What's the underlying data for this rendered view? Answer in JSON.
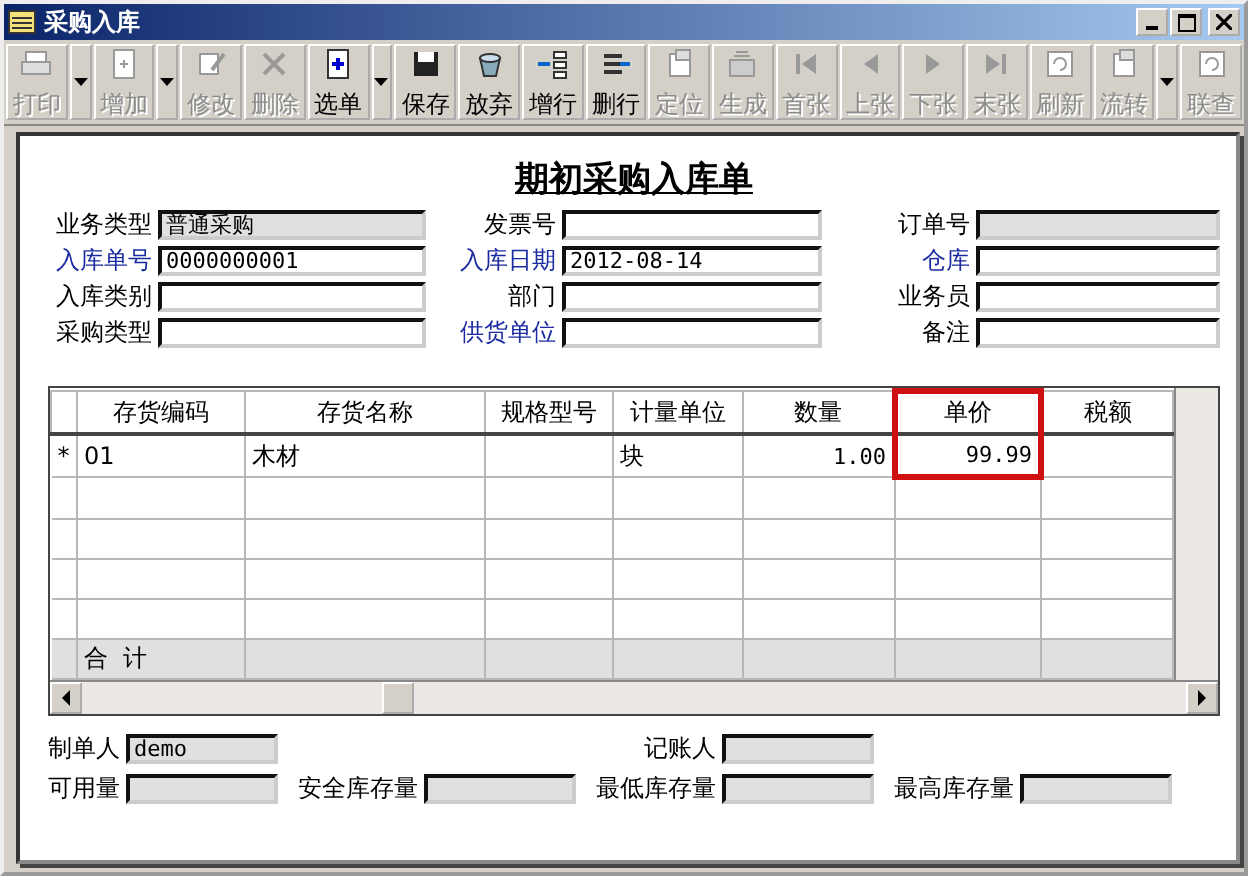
{
  "window": {
    "title": "采购入库"
  },
  "toolbar": [
    {
      "label": "打印",
      "disabled": true,
      "dropdown": true
    },
    {
      "label": "增加",
      "disabled": true,
      "dropdown": true
    },
    {
      "label": "修改",
      "disabled": true,
      "dropdown": false
    },
    {
      "label": "删除",
      "disabled": true,
      "dropdown": false
    },
    {
      "label": "选单",
      "disabled": false,
      "dropdown": true
    },
    {
      "label": "保存",
      "disabled": false,
      "dropdown": false
    },
    {
      "label": "放弃",
      "disabled": false,
      "dropdown": false
    },
    {
      "label": "增行",
      "disabled": false,
      "dropdown": false
    },
    {
      "label": "删行",
      "disabled": false,
      "dropdown": false
    },
    {
      "label": "定位",
      "disabled": true,
      "dropdown": false
    },
    {
      "label": "生成",
      "disabled": true,
      "dropdown": false
    },
    {
      "label": "首张",
      "disabled": true,
      "dropdown": false
    },
    {
      "label": "上张",
      "disabled": true,
      "dropdown": false
    },
    {
      "label": "下张",
      "disabled": true,
      "dropdown": false
    },
    {
      "label": "末张",
      "disabled": true,
      "dropdown": false
    },
    {
      "label": "刷新",
      "disabled": true,
      "dropdown": false
    },
    {
      "label": "流转",
      "disabled": true,
      "dropdown": true
    },
    {
      "label": "联查",
      "disabled": true,
      "dropdown": false
    }
  ],
  "form": {
    "title": "期初采购入库单",
    "fields": [
      {
        "label": "业务类型",
        "value": "普通采购",
        "required": false,
        "readonly": true
      },
      {
        "label": "发票号",
        "required": false,
        "readonly": false
      },
      {
        "label": "订单号",
        "required": false,
        "readonly": true
      },
      {
        "label": "入库单号",
        "value": "0000000001",
        "required": true,
        "readonly": false
      },
      {
        "label": "入库日期",
        "value": "2012-08-14",
        "required": true,
        "readonly": false
      },
      {
        "label": "仓库",
        "required": true,
        "readonly": false
      },
      {
        "label": "入库类别",
        "required": false,
        "readonly": false
      },
      {
        "label": "部门",
        "required": false,
        "readonly": false
      },
      {
        "label": "业务员",
        "required": false,
        "readonly": false
      },
      {
        "label": "采购类型",
        "required": false,
        "readonly": false
      },
      {
        "label": "供货单位",
        "required": true,
        "readonly": false
      },
      {
        "label": "备注",
        "required": false,
        "readonly": false
      }
    ]
  },
  "table": {
    "columns": [
      {
        "label": "存货编码",
        "highlighted": false
      },
      {
        "label": "存货名称",
        "highlighted": false
      },
      {
        "label": "规格型号",
        "highlighted": false
      },
      {
        "label": "计量单位",
        "highlighted": false
      },
      {
        "label": "数量",
        "highlighted": false
      },
      {
        "label": "单价",
        "highlighted": true
      },
      {
        "label": "税额",
        "highlighted": false
      }
    ],
    "rows": [
      {
        "marker": "*",
        "cells": [
          "01",
          "木材",
          "",
          "块",
          "1.00",
          "99.99",
          ""
        ]
      },
      {
        "cells": [
          "",
          "",
          "",
          "",
          "",
          "",
          ""
        ]
      },
      {
        "cells": [
          "",
          "",
          "",
          "",
          "",
          "",
          ""
        ]
      },
      {
        "cells": [
          "",
          "",
          "",
          "",
          "",
          "",
          ""
        ]
      },
      {
        "cells": [
          "",
          "",
          "",
          "",
          "",
          "",
          ""
        ]
      }
    ],
    "total_label": "合  计"
  },
  "footer": {
    "fields": [
      {
        "label": "制单人",
        "value": "demo"
      },
      {
        "label": "记账人"
      },
      {
        "label": "可用量"
      },
      {
        "label": "安全库存量"
      },
      {
        "label": "最低库存量"
      },
      {
        "label": "最高库存量"
      }
    ]
  }
}
